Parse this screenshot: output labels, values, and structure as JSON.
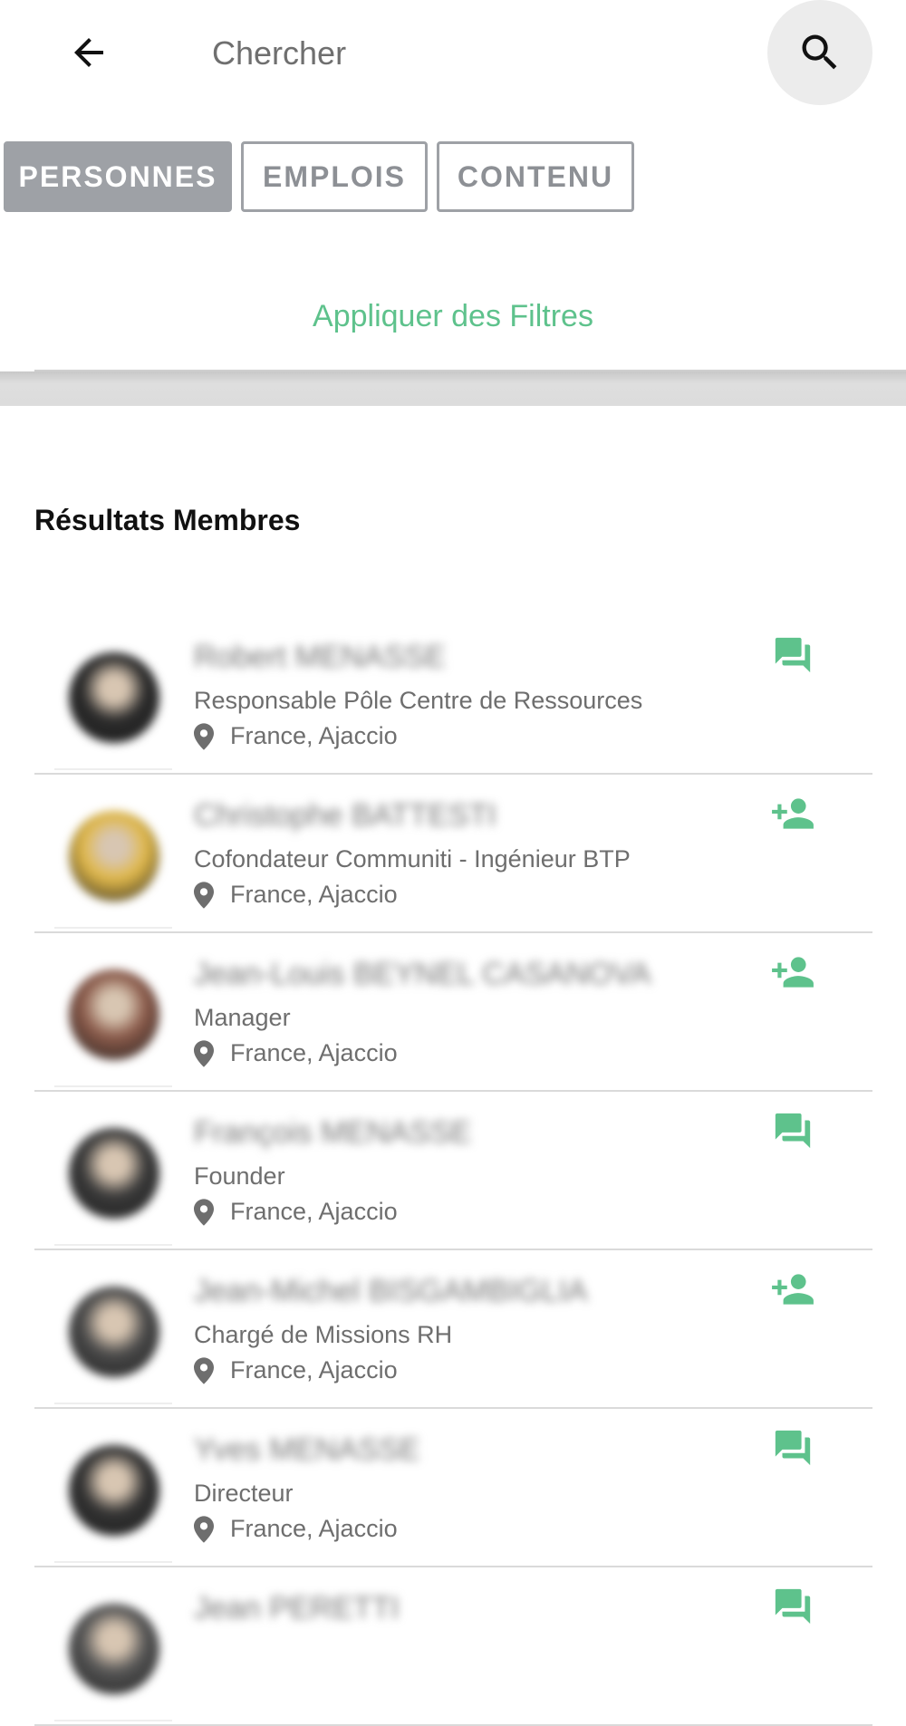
{
  "search": {
    "placeholder": "Chercher",
    "back_icon": "arrow-back-icon",
    "search_icon": "search-icon"
  },
  "tabs": [
    {
      "label": "PERSONNES",
      "active": true
    },
    {
      "label": "EMPLOIS",
      "active": false
    },
    {
      "label": "CONTENU",
      "active": false
    }
  ],
  "filters": {
    "label": "Appliquer des Filtres"
  },
  "results": {
    "title": "Résultats Membres",
    "members": [
      {
        "name": "Robert MENASSE",
        "role": "Responsable Pôle Centre de Ressources",
        "location": "France, Ajaccio",
        "action": "chat-icon",
        "avatar_color": "#2b2b2b"
      },
      {
        "name": "Christophe BATTESTI",
        "role": "Cofondateur Communiti - Ingénieur BTP",
        "location": "France, Ajaccio",
        "action": "person-add-icon",
        "avatar_color": "#e0b84a"
      },
      {
        "name": "Jean-Louis BEYNEL CASANOVA",
        "role": "Manager",
        "location": "France, Ajaccio",
        "action": "person-add-icon",
        "avatar_color": "#8a5a4a"
      },
      {
        "name": "François MENASSE",
        "role": "Founder",
        "location": "France, Ajaccio",
        "action": "chat-icon",
        "avatar_color": "#3a3a3a"
      },
      {
        "name": "Jean-Michel BISGAMBIGLIA",
        "role": "Chargé de Missions RH",
        "location": "France, Ajaccio",
        "action": "person-add-icon",
        "avatar_color": "#4a4a4a"
      },
      {
        "name": "Yves MENASSE",
        "role": "Directeur",
        "location": "France, Ajaccio",
        "action": "chat-icon",
        "avatar_color": "#333333"
      },
      {
        "name": "Jean PERETTI",
        "role": "",
        "location": "",
        "action": "chat-icon",
        "avatar_color": "#555555"
      }
    ]
  },
  "colors": {
    "accent_green": "#5ec28c",
    "tab_gray": "#9ea1a6",
    "search_button_bg": "#ececec"
  }
}
